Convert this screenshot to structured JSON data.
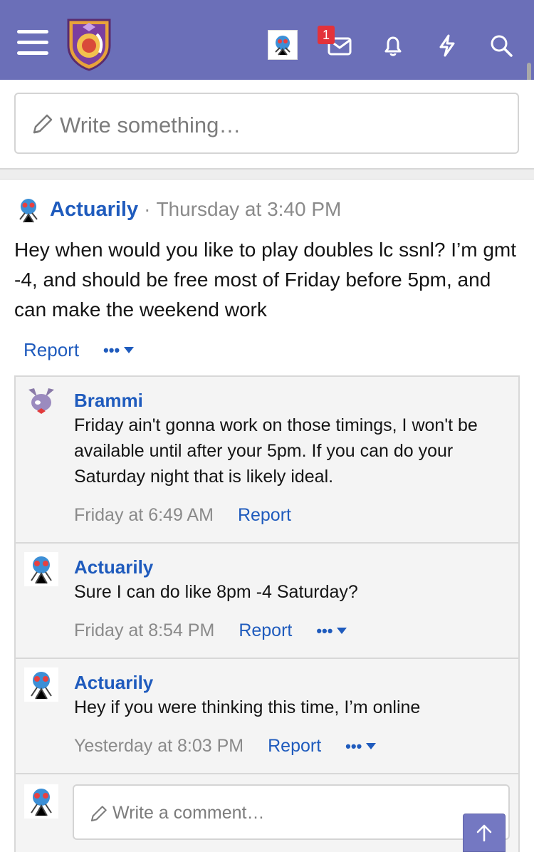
{
  "header": {
    "notification_count": "1",
    "icons": [
      "menu-icon",
      "site-logo",
      "user-avatar",
      "inbox-icon",
      "bell-icon",
      "lightning-icon",
      "search-icon"
    ]
  },
  "status": {
    "placeholder": "Write something…"
  },
  "post": {
    "author": "Actuarily",
    "separator": "·",
    "time": "Thursday at 3:40 PM",
    "body": "Hey when would you like to play doubles lc ssnl? I’m gmt -4, and should be free most of Friday before 5pm, and can make the weekend work",
    "report_label": "Report",
    "more_label": "•••"
  },
  "comments": [
    {
      "author": "Brammi",
      "text": "Friday ain't gonna work on those timings, I won't be available until after your 5pm. If you can do your Saturday night that is likely ideal.",
      "time": "Friday at 6:49 AM",
      "report_label": "Report"
    },
    {
      "author": "Actuarily",
      "text": "Sure I can do like 8pm -4 Saturday?",
      "time": "Friday at 8:54 PM",
      "report_label": "Report",
      "more_label": "•••"
    },
    {
      "author": "Actuarily",
      "text": "Hey if you were thinking this time, I’m online",
      "time": "Yesterday at 8:03 PM",
      "report_label": "Report",
      "more_label": "•••"
    }
  ],
  "reply": {
    "placeholder": "Write a comment…"
  },
  "colors": {
    "header": "#6b6fb8",
    "link": "#1f5bbd",
    "badge": "#e3323a"
  }
}
